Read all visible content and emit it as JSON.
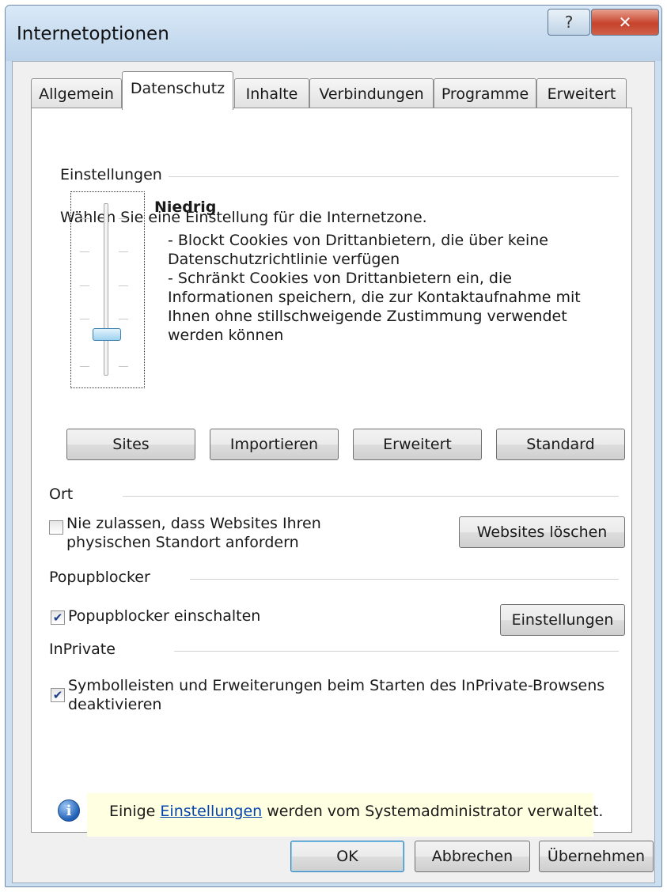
{
  "window": {
    "title": "Internetoptionen",
    "help_glyph": "?",
    "close_glyph": "✕"
  },
  "tabs": [
    {
      "label": "Allgemein",
      "active": false
    },
    {
      "label": "Datenschutz",
      "active": true
    },
    {
      "label": "Inhalte",
      "active": false
    },
    {
      "label": "Verbindungen",
      "active": false
    },
    {
      "label": "Programme",
      "active": false
    },
    {
      "label": "Erweitert",
      "active": false
    }
  ],
  "settings": {
    "group_label": "Einstellungen",
    "instruction": "Wählen Sie eine Einstellung für die Internetzone.",
    "level_title": "Niedrig",
    "level_description": [
      "- Blockt Cookies von Drittanbietern, die über keine",
      "Datenschutzrichtlinie verfügen",
      "- Schränkt Cookies von Drittanbietern ein, die",
      "Informationen speichern, die zur Kontaktaufnahme mit",
      "Ihnen ohne stillschweigende Zustimmung verwendet",
      "werden können"
    ],
    "slider_level": "Niedrig",
    "buttons": {
      "sites": "Sites",
      "import": "Importieren",
      "advanced": "Erweitert",
      "default": "Standard"
    }
  },
  "location": {
    "group_label": "Ort",
    "checkbox_label_line1": "Nie zulassen, dass Websites Ihren",
    "checkbox_label_line2": "physischen Standort anfordern",
    "checked": false,
    "clear_button": "Websites löschen"
  },
  "popup": {
    "group_label": "Popupblocker",
    "checkbox_label": "Popupblocker einschalten",
    "checked": true,
    "settings_button": "Einstellungen"
  },
  "inprivate": {
    "group_label": "InPrivate",
    "checkbox_label_line1": "Symbolleisten und Erweiterungen beim Starten des InPrivate-Browsens",
    "checkbox_label_line2": "deaktivieren",
    "checked": true
  },
  "info": {
    "icon": "info-icon",
    "prefix": "Einige",
    "link": "Einstellungen",
    "suffix": "werden vom Systemadministrator verwaltet."
  },
  "footer": {
    "ok": "OK",
    "cancel": "Abbrechen",
    "apply": "Übernehmen"
  },
  "colors": {
    "accent": "#3c7fb1",
    "link": "#0645ad",
    "info_background": "#ffffe1",
    "close_button": "#c6422b"
  }
}
